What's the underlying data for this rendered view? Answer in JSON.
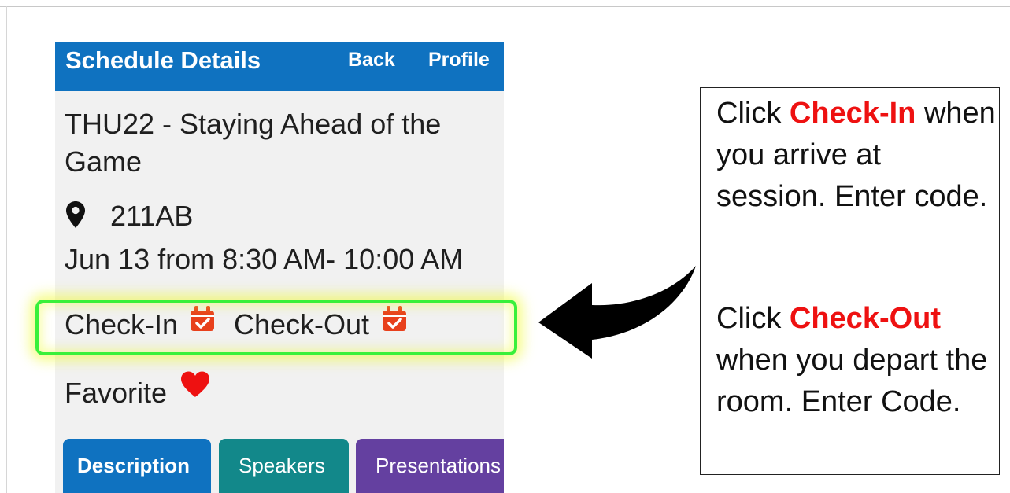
{
  "header": {
    "title": "Schedule Details",
    "back_label": "Back",
    "profile_label": "Profile"
  },
  "session": {
    "title": "THU22 - Staying Ahead of the Game",
    "location": "211AB",
    "time": "Jun 13 from 8:30 AM- 10:00 AM"
  },
  "actions": {
    "check_in_label": "Check-In",
    "check_out_label": "Check-Out",
    "favorite_label": "Favorite"
  },
  "tabs": [
    {
      "label": "Description"
    },
    {
      "label": "Speakers"
    },
    {
      "label": "Presentations"
    }
  ],
  "callout": {
    "p1_prefix": "Click",
    "p1_emphasis": "Check-In",
    "p1_text": "when you arrive at session. Enter code.",
    "p2_prefix": "Click",
    "p2_emphasis": "Check-Out",
    "p2_text": "when you depart the room. Enter Code."
  },
  "icons": {
    "location": "map-pin-icon",
    "check_in": "calendar-check-icon",
    "check_out": "calendar-check-icon",
    "favorite": "heart-icon",
    "pointer": "arrow-left-icon"
  },
  "colors": {
    "header_bg": "#0f72c0",
    "tab_description": "#0f72c0",
    "tab_speakers": "#12888a",
    "tab_presentations": "#6440a0",
    "emphasis_text": "#ee1111",
    "calendar_icon": "#e8401c",
    "heart": "#ee1111",
    "highlight_border": "#39f03a"
  }
}
